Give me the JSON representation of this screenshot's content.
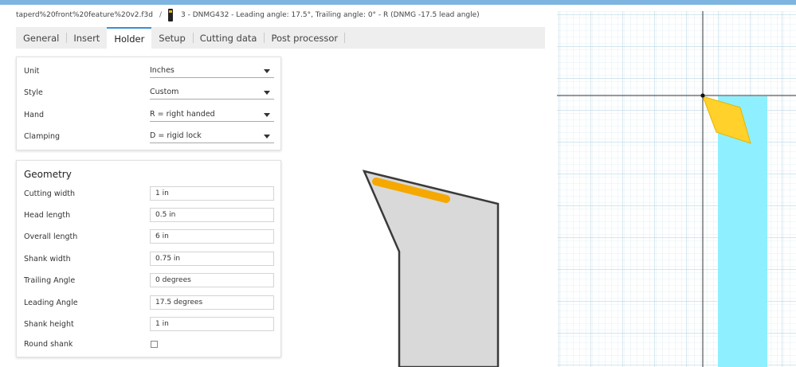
{
  "breadcrumb": {
    "file": "taperd%20front%20feature%20v2.f3d",
    "separator": "/",
    "tool": "3 - DNMG432 - Leading angle: 17.5°, Trailing angle: 0° - R (DNMG -17.5 lead angle)"
  },
  "tabs": [
    {
      "label": "General"
    },
    {
      "label": "Insert"
    },
    {
      "label": "Holder"
    },
    {
      "label": "Setup"
    },
    {
      "label": "Cutting data"
    },
    {
      "label": "Post processor"
    }
  ],
  "active_tab": "Holder",
  "holder": {
    "unit": {
      "label": "Unit",
      "value": "Inches"
    },
    "style": {
      "label": "Style",
      "value": "Custom"
    },
    "hand": {
      "label": "Hand",
      "value": "R = right handed"
    },
    "clamping": {
      "label": "Clamping",
      "value": "D = rigid lock"
    }
  },
  "geometry": {
    "title": "Geometry",
    "cutting_width": {
      "label": "Cutting width",
      "value": "1 in"
    },
    "head_length": {
      "label": "Head length",
      "value": "0.5 in"
    },
    "overall_length": {
      "label": "Overall length",
      "value": "6 in"
    },
    "shank_width": {
      "label": "Shank width",
      "value": "0.75 in"
    },
    "trailing_angle": {
      "label": "Trailing Angle",
      "value": "0 degrees"
    },
    "leading_angle": {
      "label": "Leading Angle",
      "value": "17.5 degrees"
    },
    "shank_height": {
      "label": "Shank height",
      "value": "1 in"
    },
    "round_shank": {
      "label": "Round shank",
      "checked": false
    }
  },
  "colors": {
    "accent": "#3a8fd6",
    "insert": "#f5a800",
    "holder_fill": "#d9d9d9",
    "shank_3d": "#8ef0ff",
    "insert_3d": "#ffd12a"
  },
  "icons": {
    "tool": "tool-icon",
    "dropdown": "chevron-down-icon",
    "checkbox": "checkbox-icon",
    "origin": "origin-marker"
  }
}
